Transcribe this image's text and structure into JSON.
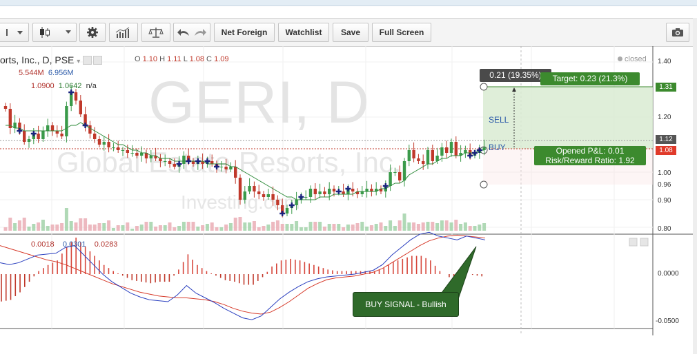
{
  "toolbar": {
    "net_foreign": "Net Foreign",
    "watchlist": "Watchlist",
    "save": "Save",
    "full_screen": "Full Screen",
    "icons": [
      "chart-style-icon",
      "dropdown-icon",
      "candlestick-icon",
      "settings-gear-icon",
      "indicators-icon",
      "compare-scale-icon",
      "undo-icon",
      "redo-icon",
      "camera-icon"
    ]
  },
  "chart": {
    "symbol": "orts, Inc., D, PSE",
    "ohlc": {
      "o_label": "O",
      "o": "1.10",
      "h_label": "H",
      "h": "1.11",
      "l_label": "L",
      "l": "1.08",
      "c_label": "C",
      "c": "1.09"
    },
    "volume": {
      "v1": "5.544M",
      "v2": "6.956M"
    },
    "ma": {
      "v1": "1.0900",
      "v2": "1.0642",
      "v3": "n/a"
    },
    "macd": {
      "v1": "0.0018",
      "v2": "0.0301",
      "v3": "0.0283"
    },
    "status": "closed",
    "watermark_title": "GERI, D",
    "watermark_sub": "Global Estate Resorts, Inc.",
    "watermark_site": "Investing.com",
    "y_axis_price": [
      "1.40",
      "1.20",
      "1.00",
      "0.96",
      "0.90",
      "0.80"
    ],
    "y_axis_macd": [
      "0.0000",
      "-0.0500"
    ],
    "price_badges": {
      "top": "1.31",
      "mid": "1.12",
      "current": "1.08"
    },
    "colors": {
      "up": "#3a9a4a",
      "down": "#c0392b",
      "macd": "#2a3fbf",
      "signal": "#d63a2a",
      "target_fill": "#d9ebd2",
      "target_box": "#3c8a2e",
      "dark_box": "#4a4a4a"
    }
  },
  "position_tool": {
    "range_label": "0.21 (19.35%)",
    "target_label": "Target: 0.23 (21.3%)",
    "sell_label": "SELL",
    "buy_label": "BUY",
    "pnl_label": "Opened P&L: 0.01",
    "rr_label": "Risk/Reward Ratio: 1.92"
  },
  "annotation": {
    "buy_signal": "BUY SIGNAL  - Bullish"
  },
  "chart_data": {
    "type": "candlestick",
    "title": "",
    "price_axis": {
      "ylim": [
        0.78,
        1.43
      ],
      "ticks": [
        1.4,
        1.2,
        1.0,
        0.9,
        0.8
      ]
    },
    "macd_axis": {
      "ylim": [
        -0.058,
        0.045
      ],
      "ticks": [
        0.0,
        -0.05
      ]
    },
    "close": [
      1.23,
      1.16,
      1.18,
      1.15,
      1.11,
      1.12,
      1.14,
      1.12,
      1.15,
      1.17,
      1.15,
      1.14,
      1.13,
      1.24,
      1.29,
      1.26,
      1.21,
      1.17,
      1.14,
      1.12,
      1.1,
      1.11,
      1.09,
      1.09,
      1.08,
      1.08,
      1.07,
      1.07,
      1.06,
      1.07,
      1.05,
      1.06,
      1.05,
      1.04,
      1.04,
      1.03,
      1.02,
      1.03,
      1.06,
      1.04,
      1.03,
      1.04,
      1.03,
      1.04,
      1.03,
      1.02,
      1.02,
      1.01,
      1.02,
      0.98,
      0.9,
      0.93,
      0.95,
      0.93,
      0.92,
      0.91,
      0.92,
      0.9,
      0.88,
      0.85,
      0.87,
      0.88,
      0.9,
      0.91,
      0.91,
      0.94,
      0.92,
      0.93,
      0.92,
      0.94,
      0.93,
      0.93,
      0.92,
      0.94,
      0.93,
      0.92,
      0.93,
      0.94,
      0.93,
      0.94,
      0.93,
      0.95,
      1.0,
      1.0,
      0.97,
      1.04,
      1.08,
      1.05,
      1.04,
      1.03,
      1.08,
      1.04,
      1.06,
      1.09,
      1.07,
      1.11,
      1.06,
      1.07,
      1.08,
      1.06,
      1.07,
      1.08,
      1.09
    ],
    "ma": [
      1.17,
      1.17,
      1.16,
      1.16,
      1.15,
      1.15,
      1.15,
      1.15,
      1.15,
      1.15,
      1.15,
      1.15,
      1.15,
      1.16,
      1.17,
      1.17,
      1.18,
      1.17,
      1.16,
      1.15,
      1.14,
      1.13,
      1.12,
      1.11,
      1.1,
      1.1,
      1.09,
      1.08,
      1.08,
      1.07,
      1.07,
      1.06,
      1.06,
      1.05,
      1.05,
      1.05,
      1.04,
      1.04,
      1.04,
      1.04,
      1.04,
      1.04,
      1.04,
      1.03,
      1.03,
      1.03,
      1.03,
      1.03,
      1.02,
      1.02,
      1.01,
      1.0,
      0.99,
      0.98,
      0.97,
      0.96,
      0.95,
      0.94,
      0.93,
      0.92,
      0.91,
      0.91,
      0.9,
      0.9,
      0.9,
      0.9,
      0.9,
      0.91,
      0.91,
      0.91,
      0.92,
      0.92,
      0.92,
      0.92,
      0.92,
      0.93,
      0.93,
      0.93,
      0.93,
      0.93,
      0.94,
      0.94,
      0.95,
      0.96,
      0.96,
      0.97,
      0.99,
      1.0,
      1.01,
      1.02,
      1.03,
      1.03,
      1.04,
      1.05,
      1.05,
      1.06,
      1.06,
      1.06,
      1.07,
      1.07,
      1.07,
      1.08,
      1.08
    ],
    "macd_line": [
      0.012,
      0.01,
      0.012,
      0.016,
      0.02,
      0.021,
      0.022,
      0.028,
      0.03,
      0.02,
      0.01,
      0.0,
      -0.008,
      -0.014,
      -0.02,
      -0.024,
      -0.027,
      -0.028,
      -0.029,
      -0.022,
      -0.012,
      -0.02,
      -0.025,
      -0.03,
      -0.036,
      -0.041,
      -0.046,
      -0.048,
      -0.044,
      -0.035,
      -0.026,
      -0.019,
      -0.013,
      -0.008,
      -0.005,
      -0.003,
      -0.002,
      -0.001,
      0.0,
      0.002,
      0.004,
      0.01,
      0.02,
      0.028,
      0.036,
      0.042,
      0.044,
      0.04,
      0.038,
      0.036,
      0.04,
      0.038,
      0.036
    ],
    "signal_line": [
      0.03,
      0.027,
      0.024,
      0.021,
      0.018,
      0.015,
      0.013,
      0.01,
      0.006,
      0.002,
      -0.002,
      -0.006,
      -0.01,
      -0.013,
      -0.016,
      -0.019,
      -0.021,
      -0.023,
      -0.024,
      -0.025,
      -0.025,
      -0.026,
      -0.027,
      -0.029,
      -0.032,
      -0.036,
      -0.039,
      -0.041,
      -0.042,
      -0.04,
      -0.035,
      -0.029,
      -0.022,
      -0.015,
      -0.01,
      -0.006,
      -0.004,
      -0.003,
      -0.002,
      0.0,
      0.002,
      0.006,
      0.012,
      0.018,
      0.024,
      0.03,
      0.035,
      0.038,
      0.04,
      0.041,
      0.04,
      0.039,
      0.038
    ]
  }
}
